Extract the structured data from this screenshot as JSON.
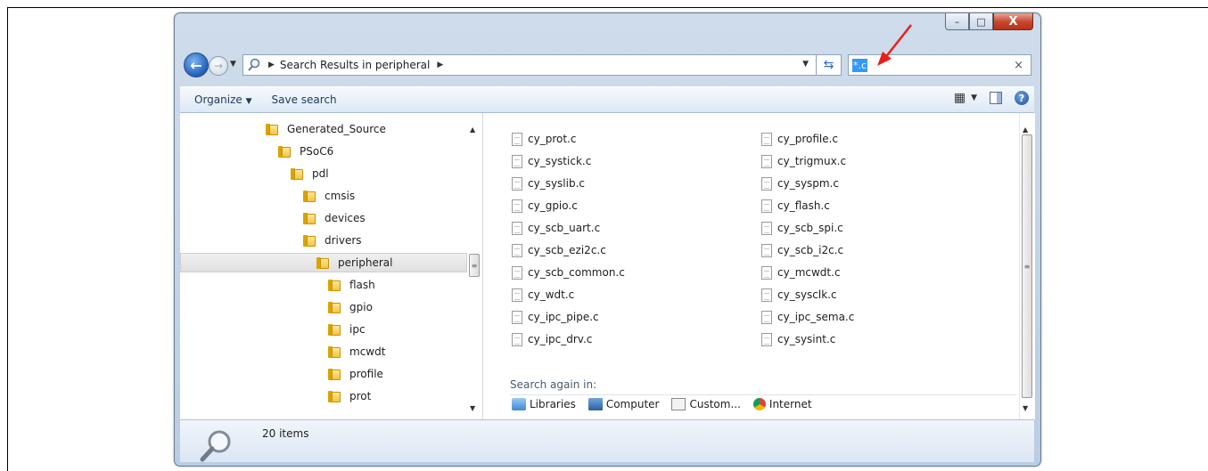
{
  "window": {
    "address": {
      "crumb": "Search Results in peripheral"
    },
    "search": {
      "value": "*.c"
    },
    "toolbar": {
      "organize": "Organize",
      "save_search": "Save search"
    },
    "caption": {
      "minimize": "–",
      "maximize": "□",
      "close": "X"
    }
  },
  "tree": [
    {
      "label": "Generated_Source",
      "indent": 0
    },
    {
      "label": "PSoC6",
      "indent": 1
    },
    {
      "label": "pdl",
      "indent": 2
    },
    {
      "label": "cmsis",
      "indent": 3
    },
    {
      "label": "devices",
      "indent": 3
    },
    {
      "label": "drivers",
      "indent": 3
    },
    {
      "label": "peripheral",
      "indent": 4,
      "selected": true
    },
    {
      "label": "flash",
      "indent": 5
    },
    {
      "label": "gpio",
      "indent": 5
    },
    {
      "label": "ipc",
      "indent": 5
    },
    {
      "label": "mcwdt",
      "indent": 5
    },
    {
      "label": "profile",
      "indent": 5
    },
    {
      "label": "prot",
      "indent": 5
    }
  ],
  "files": {
    "left": [
      "cy_prot.c",
      "cy_systick.c",
      "cy_syslib.c",
      "cy_gpio.c",
      "cy_scb_uart.c",
      "cy_scb_ezi2c.c",
      "cy_scb_common.c",
      "cy_wdt.c",
      "cy_ipc_pipe.c",
      "cy_ipc_drv.c"
    ],
    "right": [
      "cy_profile.c",
      "cy_trigmux.c",
      "cy_syspm.c",
      "cy_flash.c",
      "cy_scb_spi.c",
      "cy_scb_i2c.c",
      "cy_mcwdt.c",
      "cy_sysclk.c",
      "cy_ipc_sema.c",
      "cy_sysint.c"
    ]
  },
  "search_again": {
    "label": "Search again in:",
    "locations": [
      {
        "label": "Libraries",
        "icon": "libraries-icon"
      },
      {
        "label": "Computer",
        "icon": "computer-icon"
      },
      {
        "label": "Custom...",
        "icon": "custom-icon"
      },
      {
        "label": "Internet",
        "icon": "internet-icon"
      }
    ]
  },
  "details": {
    "count": "20 items"
  },
  "colors": {
    "annotation_arrow": "#e8201a",
    "search_highlight": "#3399ff"
  }
}
